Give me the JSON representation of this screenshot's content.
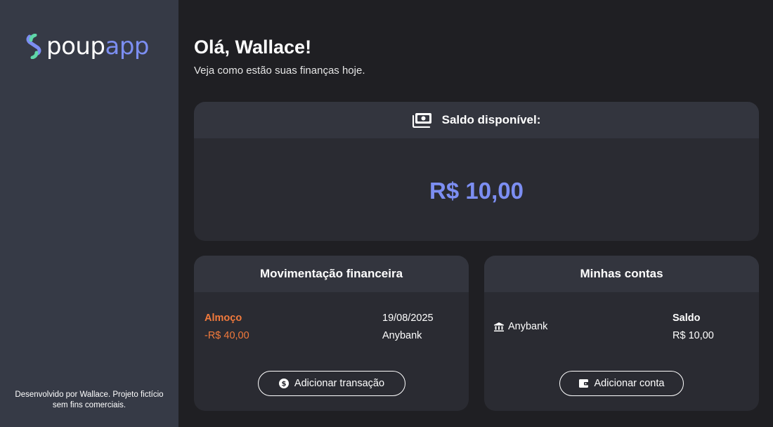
{
  "sidebar": {
    "logo_part1": "poup",
    "logo_part2": "app",
    "footer": "Desenvolvido por Wallace. Projeto fictício sem fins comerciais."
  },
  "header": {
    "greeting": "Olá, Wallace!",
    "subtitle": "Veja como estão suas finanças hoje."
  },
  "balance": {
    "title": "Saldo disponível:",
    "amount": "R$ 10,00"
  },
  "transactions": {
    "title": "Movimentação financeira",
    "items": [
      {
        "name": "Almoço",
        "value": "-R$ 40,00",
        "date": "19/08/2025",
        "bank": "Anybank"
      }
    ],
    "add_button": "Adicionar transação"
  },
  "accounts": {
    "title": "Minhas contas",
    "items": [
      {
        "bank": "Anybank",
        "label": "Saldo",
        "value": "R$ 10,00"
      }
    ],
    "add_button": "Adicionar conta"
  },
  "colors": {
    "accent": "#7c8ef2",
    "expense": "#f27a3c",
    "logo_mark_green": "#5fd6a8",
    "logo_mark_blue": "#7c8ef2"
  }
}
